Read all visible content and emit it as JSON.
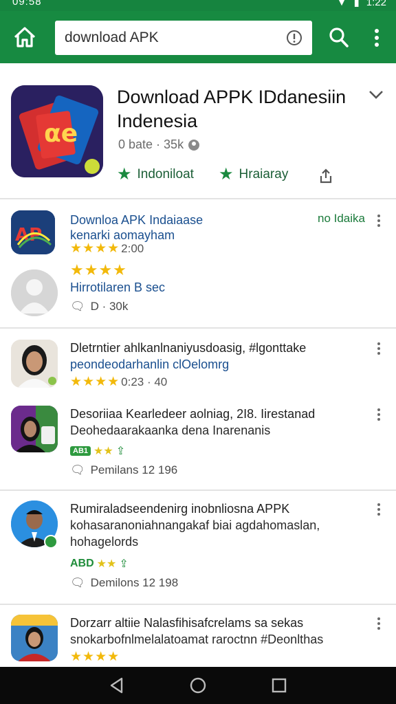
{
  "status_bar": {
    "time_left": "09:58",
    "time_right": "1:22"
  },
  "search": {
    "value": "download APK"
  },
  "featured": {
    "title": "Download APPK IDdanesiin Indenesia",
    "meta": "0 bate · 35k",
    "action1": "Indoniloat",
    "action2": "Hraiaray"
  },
  "items": [
    {
      "title": "Downloa APK Indaiaase",
      "title_suffix": "no Idaika",
      "subtitle": "kenarki aomayham",
      "rating_text": "2:00"
    },
    {
      "title": "Hirrotilaren B sec",
      "comment": "D · 30k"
    },
    {
      "title": "Dletrntier ahlkanlnaniyusdoasig, #lgonttake",
      "subtitle": "peondeodarhanlin clOelomrg",
      "rating_text": "0:23 · 40"
    },
    {
      "title": "Desoriiaa Kearledeer aolniag, 2I8. Iirestanad",
      "subtitle": "Deohedaarakaanka dena Inarenanis",
      "badge": "AB1",
      "comment": "Pemilans 12 196"
    },
    {
      "title": "Rumiraladseendenirg inobnliosna APPK",
      "subtitle": "kohasaranoniahnangakaf biai agdahomaslan,",
      "subtitle2": "hohagelords",
      "badge_text": "ABD",
      "comment": "Demilons 12 198"
    },
    {
      "title": "Dorzarr altiie Nalasfihisafcrelams sa sekas",
      "subtitle": "snokarbofnlmelalatoamat raroctnn #Deonlthas"
    }
  ]
}
